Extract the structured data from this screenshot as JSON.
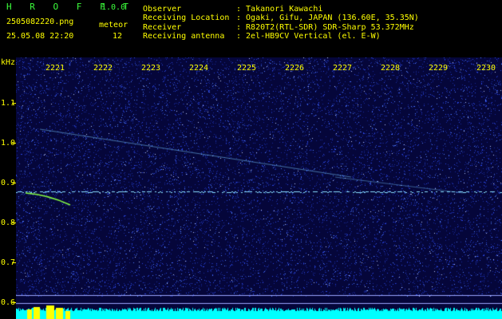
{
  "header": {
    "app_name": "H R O F F T",
    "version": "1.0.0",
    "filename": "2505082220.png",
    "meteor_label": "meteor",
    "datetime": "25.05.08 22:20",
    "meteor_count": "12",
    "fields": [
      {
        "label": "Observer",
        "value": ": Takanori Kawachi"
      },
      {
        "label": "Receiving Location",
        "value": ": Ogaki, Gifu, JAPAN (136.60E, 35.35N)"
      },
      {
        "label": "Receiver",
        "value": ": R820T2(RTL-SDR) SDR-Sharp 53.372MHz"
      },
      {
        "label": "Receiving antenna",
        "value": ": 2el-HB9CV Vertical (el. E-W)"
      }
    ]
  },
  "axis": {
    "unit": "kHz",
    "y_ticks": [
      "1.1",
      "1.0",
      "0.9",
      "0.8",
      "0.7",
      "0.6"
    ],
    "x_ticks": [
      "2221",
      "2222",
      "2223",
      "2224",
      "2225",
      "2226",
      "2227",
      "2228",
      "2229",
      "2230"
    ]
  },
  "colors": {
    "text": "#ffffff",
    "green": "#3cff3c",
    "yellow": "#ffff00",
    "background": "#05063a",
    "noise": "#2233ff",
    "carrier": "#88ddff",
    "meteor": "#88ff44",
    "level": "#00ffff"
  }
}
